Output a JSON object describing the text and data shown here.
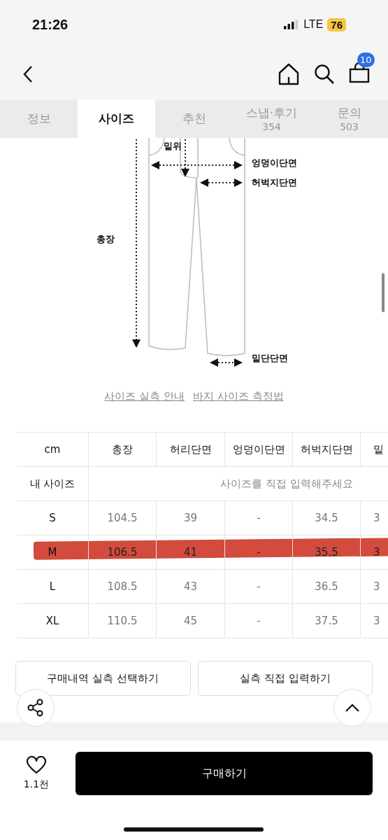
{
  "status_bar": {
    "time": "21:26",
    "network": "LTE",
    "battery": "76"
  },
  "nav": {
    "cart_count": "10"
  },
  "tabs": [
    {
      "label": "정보",
      "selected": false
    },
    {
      "label": "사이즈",
      "selected": true
    },
    {
      "label": "추천",
      "selected": false
    },
    {
      "label": "스냅·후기",
      "count": "354",
      "selected": false
    },
    {
      "label": "문의",
      "count": "503",
      "selected": false
    }
  ],
  "diagram": {
    "labels": [
      "밑위",
      "엉덩이단면",
      "허벅지단면",
      "총장",
      "밑단단면"
    ]
  },
  "links": [
    "사이즈 실측 안내",
    "바지 사이즈 측정법"
  ],
  "table": {
    "columns": [
      "cm",
      "총장",
      "허리단면",
      "엉덩이단면",
      "허벅지단면",
      "밑"
    ],
    "my_size": {
      "label": "내 사이즈",
      "placeholder": "사이즈를 직접 입력해주세요"
    },
    "rows": [
      {
        "cells": [
          "S",
          "104.5",
          "39",
          "-",
          "34.5",
          "3"
        ],
        "marked": false
      },
      {
        "cells": [
          "M",
          "106.5",
          "41",
          "-",
          "35.5",
          "3"
        ],
        "marked": true
      },
      {
        "cells": [
          "L",
          "108.5",
          "43",
          "-",
          "36.5",
          "3"
        ],
        "marked": false
      },
      {
        "cells": [
          "XL",
          "110.5",
          "45",
          "-",
          "37.5",
          "3"
        ],
        "marked": false
      }
    ]
  },
  "buttons": [
    "구매내역 실측 선택하기",
    "실측 직접 입력하기"
  ],
  "bottom_bar": {
    "likes": "1.1천",
    "buy_label": "구매하기"
  }
}
